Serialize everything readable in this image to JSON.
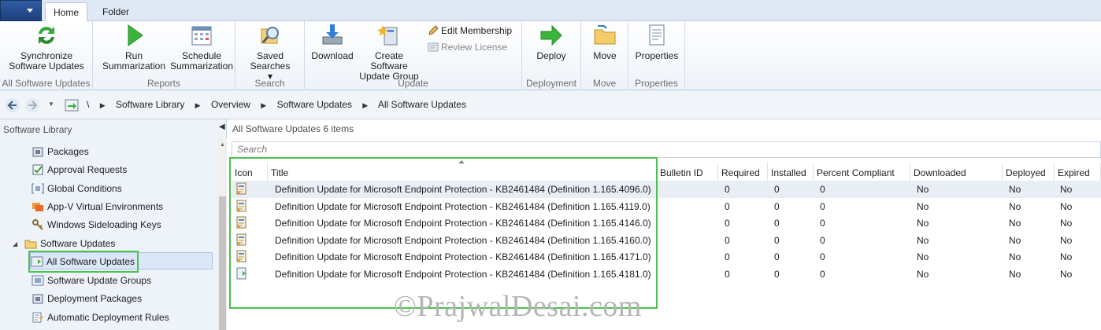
{
  "tabs": [
    "Home",
    "Folder"
  ],
  "ribbon": {
    "groups": [
      {
        "label": "All Software Updates",
        "buttons": [
          "Synchronize\nSoftware Updates"
        ]
      },
      {
        "label": "Reports",
        "buttons": [
          "Run\nSummarization",
          "Schedule\nSummarization"
        ]
      },
      {
        "label": "Search",
        "buttons": [
          "Saved\nSearches ▾"
        ]
      },
      {
        "label": "Update",
        "buttons": [
          "Download",
          "Create Software\nUpdate Group"
        ],
        "small": [
          "Edit Membership",
          "Review License"
        ]
      },
      {
        "label": "Deployment",
        "buttons": [
          "Deploy"
        ]
      },
      {
        "label": "Move",
        "buttons": [
          "Move"
        ]
      },
      {
        "label": "Properties",
        "buttons": [
          "Properties"
        ]
      }
    ]
  },
  "breadcrumb": [
    "\\",
    "Software Library",
    "Overview",
    "Software Updates",
    "All Software Updates"
  ],
  "nav": {
    "title": "Software Library",
    "items": [
      {
        "label": "Packages",
        "icon": "package-icon"
      },
      {
        "label": "Approval Requests",
        "icon": "approval-icon"
      },
      {
        "label": "Global Conditions",
        "icon": "conditions-icon"
      },
      {
        "label": "App-V Virtual Environments",
        "icon": "appv-icon"
      },
      {
        "label": "Windows Sideloading Keys",
        "icon": "keys-icon"
      },
      {
        "label": "Software Updates",
        "icon": "folder-icon"
      },
      {
        "label": "All Software Updates",
        "icon": "update-icon"
      },
      {
        "label": "Software Update Groups",
        "icon": "update-group-icon"
      },
      {
        "label": "Deployment Packages",
        "icon": "package-icon"
      },
      {
        "label": "Automatic Deployment Rules",
        "icon": "rules-icon"
      }
    ]
  },
  "main": {
    "title": "All Software Updates 6 items",
    "search_placeholder": "Search",
    "columns": [
      "Icon",
      "Title",
      "Bulletin ID",
      "Required",
      "Installed",
      "Percent Compliant",
      "Downloaded",
      "Deployed",
      "Expired"
    ],
    "rows": [
      {
        "title": "Definition Update for Microsoft Endpoint Protection - KB2461484 (Definition 1.165.4096.0)",
        "bulletin": "",
        "required": "0",
        "installed": "0",
        "percent": "0",
        "downloaded": "No",
        "deployed": "No",
        "expired": "No"
      },
      {
        "title": "Definition Update for Microsoft Endpoint Protection - KB2461484 (Definition 1.165.4119.0)",
        "bulletin": "",
        "required": "0",
        "installed": "0",
        "percent": "0",
        "downloaded": "No",
        "deployed": "No",
        "expired": "No"
      },
      {
        "title": "Definition Update for Microsoft Endpoint Protection - KB2461484 (Definition 1.165.4146.0)",
        "bulletin": "",
        "required": "0",
        "installed": "0",
        "percent": "0",
        "downloaded": "No",
        "deployed": "No",
        "expired": "No"
      },
      {
        "title": "Definition Update for Microsoft Endpoint Protection - KB2461484 (Definition 1.165.4160.0)",
        "bulletin": "",
        "required": "0",
        "installed": "0",
        "percent": "0",
        "downloaded": "No",
        "deployed": "No",
        "expired": "No"
      },
      {
        "title": "Definition Update for Microsoft Endpoint Protection - KB2461484 (Definition 1.165.4171.0)",
        "bulletin": "",
        "required": "0",
        "installed": "0",
        "percent": "0",
        "downloaded": "No",
        "deployed": "No",
        "expired": "No"
      },
      {
        "title": "Definition Update for Microsoft Endpoint Protection - KB2461484 (Definition 1.165.4181.0)",
        "bulletin": "",
        "required": "0",
        "installed": "0",
        "percent": "0",
        "downloaded": "No",
        "deployed": "No",
        "expired": "No"
      }
    ]
  },
  "watermark": "©PrajwalDesai.com",
  "colors": {
    "highlight": "#4bc24b",
    "accent": "#1c3f7a"
  }
}
